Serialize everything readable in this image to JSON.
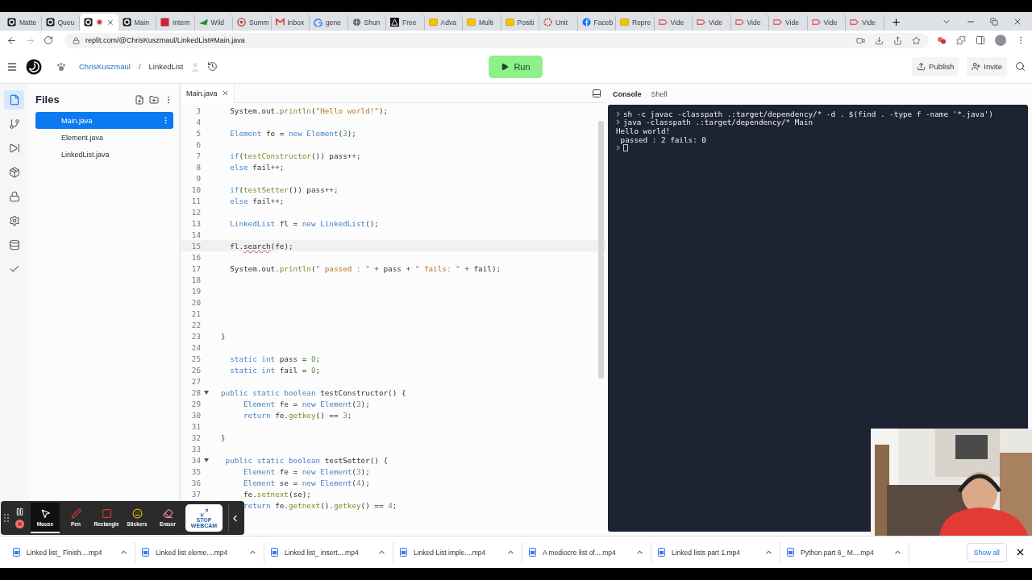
{
  "browser": {
    "tabs": [
      {
        "label": "Matte",
        "selected": false,
        "recording": false,
        "kind": "replit"
      },
      {
        "label": "Queu",
        "selected": false,
        "recording": false,
        "kind": "replit"
      },
      {
        "selected": true,
        "recording": true,
        "kind": "replit"
      },
      {
        "label": "Main",
        "selected": false,
        "recording": false,
        "kind": "replit"
      },
      {
        "label": "Intern",
        "selected": false,
        "recording": false,
        "kind": "red"
      },
      {
        "label": "Wild",
        "selected": false,
        "recording": false,
        "kind": "wild"
      },
      {
        "label": "Summ",
        "selected": false,
        "recording": false,
        "kind": "target"
      },
      {
        "label": "Inbox",
        "selected": false,
        "recording": false,
        "kind": "mail"
      },
      {
        "label": "gene",
        "selected": false,
        "recording": false,
        "kind": "google"
      },
      {
        "label": "Shun",
        "selected": false,
        "recording": false,
        "kind": "globe"
      },
      {
        "label": "Free",
        "selected": false,
        "recording": false,
        "kind": "triangle"
      },
      {
        "label": "Adva",
        "selected": false,
        "recording": false,
        "kind": "folder"
      },
      {
        "label": "Multi",
        "selected": false,
        "recording": false,
        "kind": "folder"
      },
      {
        "label": "Positi",
        "selected": false,
        "recording": false,
        "kind": "folder"
      },
      {
        "label": "Unit",
        "selected": false,
        "recording": false,
        "kind": "dashed"
      },
      {
        "label": "Faceb",
        "selected": false,
        "recording": false,
        "kind": "facebook"
      },
      {
        "label": "Repre",
        "selected": false,
        "recording": false,
        "kind": "folder"
      },
      {
        "label": "Vide",
        "selected": false,
        "recording": false,
        "kind": "video"
      },
      {
        "label": "Vide",
        "selected": false,
        "recording": false,
        "kind": "video"
      },
      {
        "label": "Vide",
        "selected": false,
        "recording": false,
        "kind": "video"
      },
      {
        "label": "Vide",
        "selected": false,
        "recording": false,
        "kind": "video"
      },
      {
        "label": "Vide",
        "selected": false,
        "recording": false,
        "kind": "video"
      },
      {
        "label": "Vide",
        "selected": false,
        "recording": false,
        "kind": "video"
      }
    ],
    "address": "replit.com/@ChrisKuszmaul/LinkedList#Main.java"
  },
  "header": {
    "user": "ChrisKuszmaul",
    "separator": "/",
    "repl": "LinkedList",
    "run": "Run",
    "publish": "Publish",
    "invite": "Invite"
  },
  "rail": [
    {
      "kind": "files",
      "selected": true
    },
    {
      "kind": "git",
      "selected": false
    },
    {
      "kind": "debug",
      "selected": false
    },
    {
      "kind": "packages",
      "selected": false
    },
    {
      "kind": "secrets",
      "selected": false
    },
    {
      "kind": "settings",
      "selected": false
    },
    {
      "kind": "database",
      "selected": false
    },
    {
      "kind": "tests",
      "selected": false
    }
  ],
  "files": {
    "title": "Files",
    "items": [
      {
        "name": "Main.java",
        "selected": true
      },
      {
        "name": "Element.java",
        "selected": false
      },
      {
        "name": "LinkedList.java",
        "selected": false
      }
    ]
  },
  "editor": {
    "tab": "Main.java",
    "lines": [
      {
        "number": "3",
        "active": false,
        "fold": false,
        "tokens": [
          {
            "kind": "plain",
            "text": "  System.out."
          },
          {
            "kind": "method",
            "text": "println"
          },
          {
            "kind": "plain",
            "text": "("
          },
          {
            "kind": "string",
            "text": "\"Hello world!\""
          },
          {
            "kind": "plain",
            "text": ");"
          }
        ]
      },
      {
        "number": "4",
        "active": false,
        "fold": false
      },
      {
        "number": "5",
        "active": false,
        "fold": false,
        "tokens": [
          {
            "kind": "keyword",
            "text": "  Element"
          },
          {
            "kind": "plain",
            "text": " fe = "
          },
          {
            "kind": "keyword",
            "text": "new Element"
          },
          {
            "kind": "plain",
            "text": "("
          },
          {
            "kind": "number",
            "text": "3"
          },
          {
            "kind": "plain",
            "text": ");"
          }
        ]
      },
      {
        "number": "6",
        "active": false,
        "fold": false
      },
      {
        "number": "7",
        "active": false,
        "fold": false,
        "tokens": [
          {
            "kind": "keyword",
            "text": "  if"
          },
          {
            "kind": "plain",
            "text": "("
          },
          {
            "kind": "method",
            "text": "testConstructor"
          },
          {
            "kind": "plain",
            "text": "()) pass++;"
          }
        ]
      },
      {
        "number": "8",
        "active": false,
        "fold": false,
        "tokens": [
          {
            "kind": "keyword",
            "text": "  else"
          },
          {
            "kind": "plain",
            "text": " fail++;"
          }
        ]
      },
      {
        "number": "9",
        "active": false,
        "fold": false
      },
      {
        "number": "10",
        "active": false,
        "fold": false,
        "tokens": [
          {
            "kind": "keyword",
            "text": "  if"
          },
          {
            "kind": "plain",
            "text": "("
          },
          {
            "kind": "method",
            "text": "testSetter"
          },
          {
            "kind": "plain",
            "text": "()) pass++;"
          }
        ]
      },
      {
        "number": "11",
        "active": false,
        "fold": false,
        "tokens": [
          {
            "kind": "keyword",
            "text": "  else"
          },
          {
            "kind": "plain",
            "text": " fail++;"
          }
        ]
      },
      {
        "number": "12",
        "active": false,
        "fold": false
      },
      {
        "number": "13",
        "active": false,
        "fold": false,
        "tokens": [
          {
            "kind": "keyword",
            "text": "  LinkedList"
          },
          {
            "kind": "plain",
            "text": " fl = "
          },
          {
            "kind": "keyword",
            "text": "new LinkedList"
          },
          {
            "kind": "plain",
            "text": "();"
          }
        ]
      },
      {
        "number": "14",
        "active": false,
        "fold": false
      },
      {
        "number": "15",
        "active": true,
        "fold": false,
        "tokens": [
          {
            "kind": "plain",
            "text": "  fl."
          },
          {
            "kind": "error",
            "text": "search"
          },
          {
            "kind": "plain",
            "text": "(fe);"
          }
        ]
      },
      {
        "number": "16",
        "active": false,
        "fold": false
      },
      {
        "number": "17",
        "active": false,
        "fold": false,
        "tokens": [
          {
            "kind": "plain",
            "text": "  System.out."
          },
          {
            "kind": "method",
            "text": "println"
          },
          {
            "kind": "plain",
            "text": "("
          },
          {
            "kind": "string",
            "text": "\" passed : \""
          },
          {
            "kind": "plain",
            "text": " + pass + "
          },
          {
            "kind": "string",
            "text": "\" fails: \""
          },
          {
            "kind": "plain",
            "text": " + fail);"
          }
        ]
      },
      {
        "number": "18",
        "active": false,
        "fold": false
      },
      {
        "number": "19",
        "active": false,
        "fold": false
      },
      {
        "number": "20",
        "active": false,
        "fold": false
      },
      {
        "number": "21",
        "active": false,
        "fold": false
      },
      {
        "number": "22",
        "active": false,
        "fold": false
      },
      {
        "number": "23",
        "active": false,
        "fold": false,
        "tokens": [
          {
            "kind": "plain",
            "text": "}"
          }
        ]
      },
      {
        "number": "24",
        "active": false,
        "fold": false
      },
      {
        "number": "25",
        "active": false,
        "fold": false,
        "tokens": [
          {
            "kind": "keyword",
            "text": "  static int"
          },
          {
            "kind": "plain",
            "text": " pass = "
          },
          {
            "kind": "number",
            "text": "0"
          },
          {
            "kind": "plain",
            "text": ";"
          }
        ]
      },
      {
        "number": "26",
        "active": false,
        "fold": false,
        "tokens": [
          {
            "kind": "keyword",
            "text": "  static int"
          },
          {
            "kind": "plain",
            "text": " fail = "
          },
          {
            "kind": "number",
            "text": "0"
          },
          {
            "kind": "plain",
            "text": ";"
          }
        ]
      },
      {
        "number": "27",
        "active": false,
        "fold": false
      },
      {
        "number": "28",
        "active": false,
        "fold": true,
        "tokens": [
          {
            "kind": "keyword",
            "text": "public static boolean"
          },
          {
            "kind": "plain",
            "text": " testConstructor() {"
          }
        ]
      },
      {
        "number": "29",
        "active": false,
        "fold": false,
        "tokens": [
          {
            "kind": "keyword",
            "text": "     Element"
          },
          {
            "kind": "plain",
            "text": " fe = "
          },
          {
            "kind": "keyword",
            "text": "new Element"
          },
          {
            "kind": "plain",
            "text": "("
          },
          {
            "kind": "number",
            "text": "3"
          },
          {
            "kind": "plain",
            "text": ");"
          }
        ]
      },
      {
        "number": "30",
        "active": false,
        "fold": false,
        "tokens": [
          {
            "kind": "keyword",
            "text": "     return"
          },
          {
            "kind": "plain",
            "text": " fe."
          },
          {
            "kind": "method",
            "text": "getkey"
          },
          {
            "kind": "plain",
            "text": "() == "
          },
          {
            "kind": "number",
            "text": "3"
          },
          {
            "kind": "plain",
            "text": ";"
          }
        ]
      },
      {
        "number": "31",
        "active": false,
        "fold": false
      },
      {
        "number": "32",
        "active": false,
        "fold": false,
        "tokens": [
          {
            "kind": "plain",
            "text": "}"
          }
        ]
      },
      {
        "number": "33",
        "active": false,
        "fold": false
      },
      {
        "number": "34",
        "active": false,
        "fold": true,
        "tokens": [
          {
            "kind": "keyword",
            "text": " public static boolean"
          },
          {
            "kind": "plain",
            "text": " testSetter() {"
          }
        ]
      },
      {
        "number": "35",
        "active": false,
        "fold": false,
        "tokens": [
          {
            "kind": "keyword",
            "text": "     Element"
          },
          {
            "kind": "plain",
            "text": " fe = "
          },
          {
            "kind": "keyword",
            "text": "new Element"
          },
          {
            "kind": "plain",
            "text": "("
          },
          {
            "kind": "number",
            "text": "3"
          },
          {
            "kind": "plain",
            "text": ");"
          }
        ]
      },
      {
        "number": "36",
        "active": false,
        "fold": false,
        "tokens": [
          {
            "kind": "keyword",
            "text": "     Element"
          },
          {
            "kind": "plain",
            "text": " se = "
          },
          {
            "kind": "keyword",
            "text": "new Element"
          },
          {
            "kind": "plain",
            "text": "("
          },
          {
            "kind": "number",
            "text": "4"
          },
          {
            "kind": "plain",
            "text": ");"
          }
        ]
      },
      {
        "number": "37",
        "active": false,
        "fold": false,
        "tokens": [
          {
            "kind": "plain",
            "text": "     fe."
          },
          {
            "kind": "method",
            "text": "setnext"
          },
          {
            "kind": "plain",
            "text": "(se);"
          }
        ]
      },
      {
        "active": false,
        "fold": false,
        "tokens": [
          {
            "kind": "keyword",
            "text": "     return"
          },
          {
            "kind": "plain",
            "text": " fe."
          },
          {
            "kind": "method",
            "text": "getnext"
          },
          {
            "kind": "plain",
            "text": "()."
          },
          {
            "kind": "method",
            "text": "getkey"
          },
          {
            "kind": "plain",
            "text": "() == "
          },
          {
            "kind": "number",
            "text": "4"
          },
          {
            "kind": "plain",
            "text": ";"
          }
        ]
      }
    ]
  },
  "console": {
    "tabs": [
      {
        "label": "Console",
        "selected": true
      },
      {
        "label": "Shell",
        "selected": false
      }
    ],
    "lines": [
      {
        "kind": "command",
        "text": "sh -c javac -classpath .:target/dependency/* -d . $(find . -type f -name '*.java')"
      },
      {
        "kind": "command",
        "text": "java -classpath .:target/dependency/* Main"
      },
      {
        "kind": "output",
        "text": "Hello world!"
      },
      {
        "kind": "output",
        "text": " passed : 2 fails: 0"
      },
      {
        "kind": "input"
      }
    ]
  },
  "recorder": {
    "tools": [
      {
        "kind": "mouse",
        "label": "Mouse",
        "selected": true
      },
      {
        "kind": "pen",
        "label": "Pen",
        "selected": false
      },
      {
        "kind": "rectangle",
        "label": "Rectangle",
        "selected": false
      },
      {
        "kind": "stickers",
        "label": "Stickers",
        "selected": false
      },
      {
        "kind": "eraser",
        "label": "Eraser",
        "selected": false
      }
    ],
    "webcam": "STOP WEBCAM"
  },
  "downloads": {
    "items": [
      "Linked list_ Finish....mp4",
      "Linked list eleme....mp4",
      "Linked list_ insert....mp4",
      "Linked List imple....mp4",
      "A mediocre list of....mp4",
      "Linked lists part 1.mp4",
      "Python part 6_ M....mp4"
    ],
    "show_all": "Show all"
  }
}
